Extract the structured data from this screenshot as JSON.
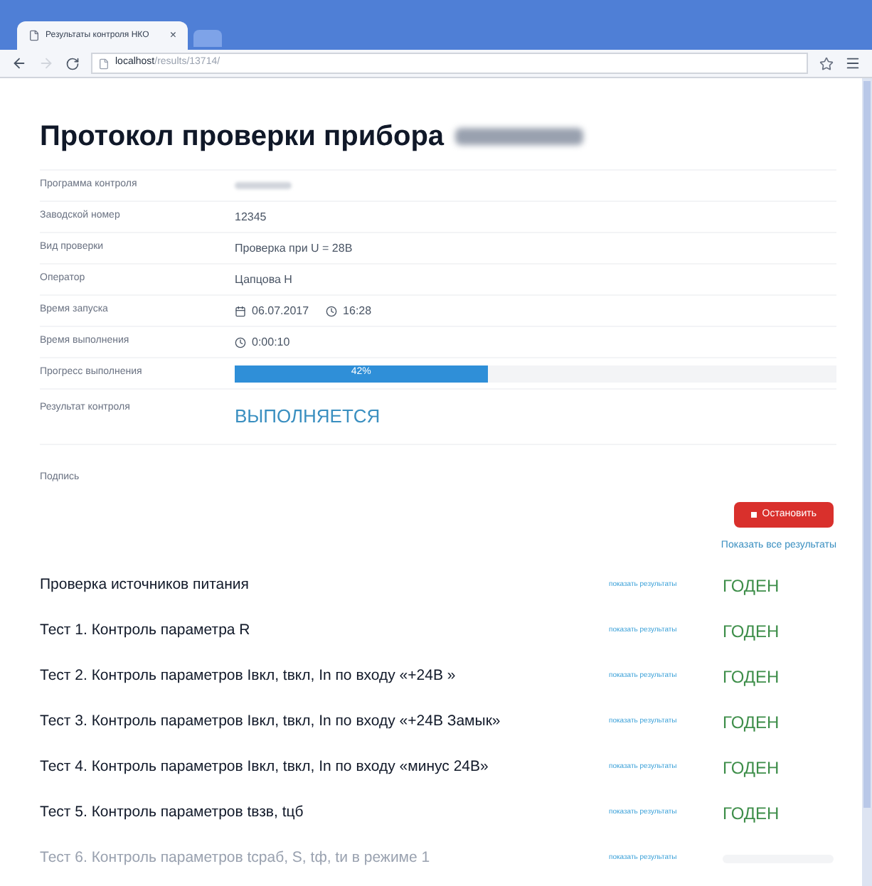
{
  "browser": {
    "tab_title": "Результаты контроля НКО",
    "tab_close": "×",
    "url_host": "localhost",
    "url_path": "/results/13714/"
  },
  "protocol": {
    "title": "Протокол проверки прибора",
    "fields": [
      {
        "label": "Программа контроля",
        "kind": "redacted"
      },
      {
        "label": "Заводской номер",
        "kind": "text",
        "value": "12345"
      },
      {
        "label": "Вид проверки",
        "kind": "text",
        "value": "Проверка при U = 28В"
      },
      {
        "label": "Оператор",
        "kind": "text",
        "value": "Цапцова Н"
      },
      {
        "label": "Время запуска",
        "kind": "datetime",
        "date": "06.07.2017",
        "time": "16:28"
      },
      {
        "label": "Время выполнения",
        "kind": "duration",
        "time": "0:00:10"
      },
      {
        "label": "Прогресс выполнения",
        "kind": "progress",
        "level": 0.42,
        "reading": "42%"
      }
    ],
    "result": {
      "label": "Результат контроля",
      "value": "ВЫПОЛНЯЕТСЯ"
    },
    "signature": {
      "label": "Подпись"
    },
    "stop_button": "Остановить",
    "show_all_link": "Показать все результаты"
  },
  "tests": [
    {
      "name": "Проверка источников питания",
      "link": "показать результаты",
      "finished": true,
      "status": "ГОДЕН"
    },
    {
      "name": "Тест 1. Контроль параметра R",
      "link": "показать результаты",
      "finished": true,
      "status": "ГОДЕН"
    },
    {
      "name": "Тест 2. Контроль параметров Iвкл, tвкл, In по входу «+24В »",
      "link": "показать результаты",
      "finished": true,
      "status": "ГОДЕН"
    },
    {
      "name": "Тест 3. Контроль параметров Iвкл, tвкл, In по входу «+24В Замык»",
      "link": "показать результаты",
      "finished": true,
      "status": "ГОДЕН"
    },
    {
      "name": "Тест 4. Контроль параметров Iвкл, tвкл, In по входу «минус 24В»",
      "link": "показать результаты",
      "finished": true,
      "status": "ГОДЕН"
    },
    {
      "name": "Тест 5. Контроль параметров tвзв, tцб",
      "link": "показать результаты",
      "finished": true,
      "status": "ГОДЕН"
    },
    {
      "name": "Тест 6. Контроль параметров tсраб, S, tф, tи в режиме 1",
      "link": "показать результаты",
      "finished": false
    }
  ]
}
